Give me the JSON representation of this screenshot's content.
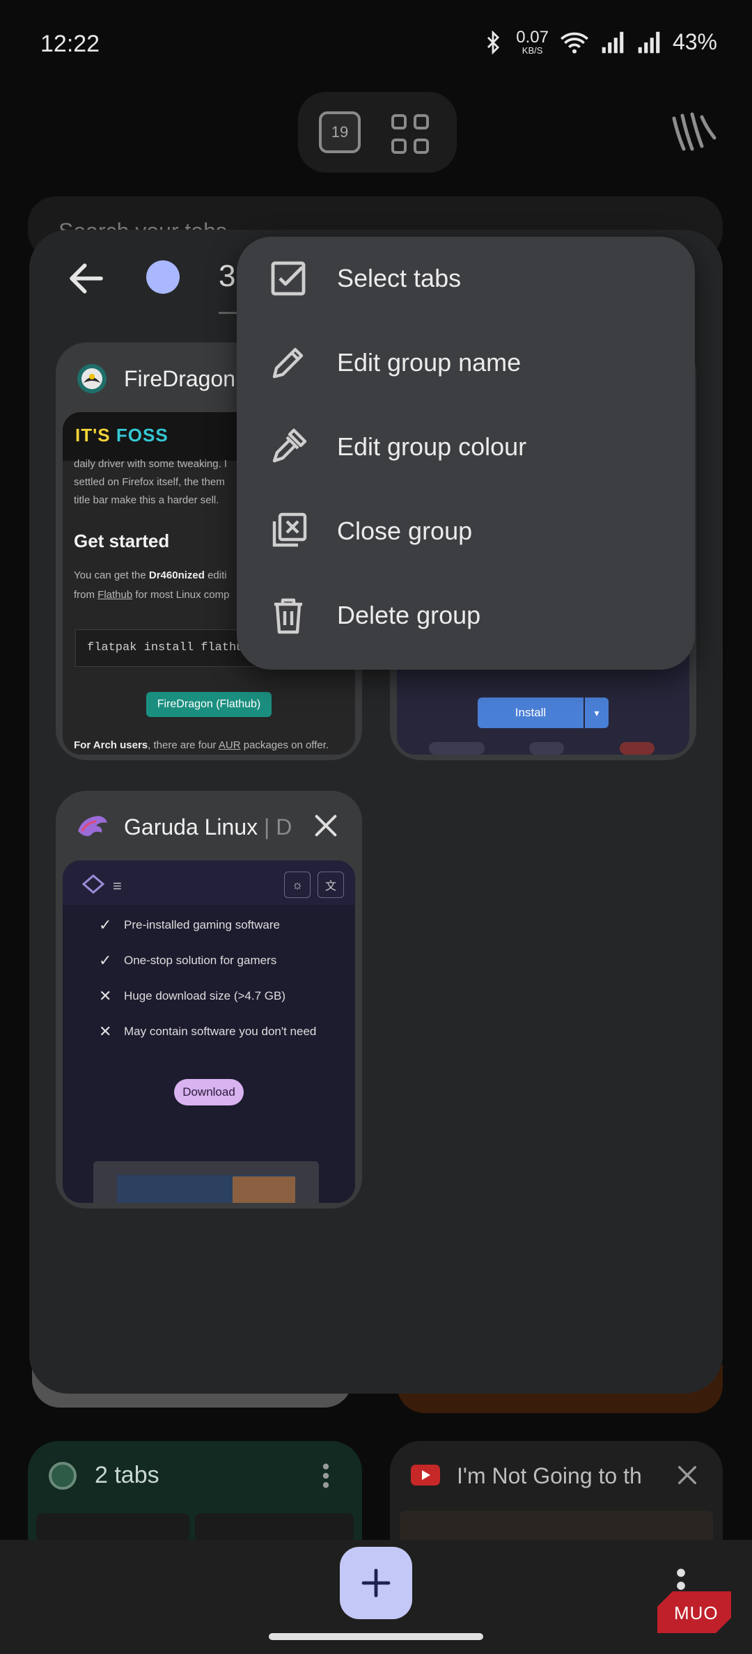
{
  "status_bar": {
    "time": "12:22",
    "net_speed_value": "0.07",
    "net_speed_unit": "KB/S",
    "battery": "43%",
    "icons": [
      "bluetooth-icon",
      "wifi-icon",
      "signal-icon",
      "signal-icon",
      "battery-icon"
    ]
  },
  "switcher": {
    "tab_count": "19"
  },
  "background": {
    "search_placeholder": "Search your tabs"
  },
  "group": {
    "color": "#a9b8ff",
    "name_partial": "3"
  },
  "menu": {
    "items": [
      {
        "label": "Select tabs",
        "icon": "checkbox-icon"
      },
      {
        "label": "Edit group name",
        "icon": "pencil-icon"
      },
      {
        "label": "Edit group colour",
        "icon": "color-picker-icon"
      },
      {
        "label": "Close group",
        "icon": "close-group-icon"
      },
      {
        "label": "Delete group",
        "icon": "trash-icon"
      }
    ]
  },
  "tabs": [
    {
      "title": "FireDragon",
      "thumbnail": {
        "logo_a": "IT'S",
        "logo_b": "FOSS",
        "line1": "daily driver with some tweaking. I",
        "line2": "settled on Firefox itself, the them",
        "line3": "title bar make this a harder sell.",
        "heading": "Get started",
        "body1a": "You can get the ",
        "body1b": "Dr460nized",
        "body1c": " editi",
        "body2a": "from ",
        "body2b": "Flathub",
        "body2c": " for most Linux comp",
        "code": "flatpak install flathub org",
        "button": "FireDragon (Flathub)",
        "footer_a": "For Arch users",
        "footer_b": ", there are four ",
        "footer_c": "AUR",
        "footer_d": " packages on offer."
      }
    },
    {
      "title": "",
      "thumbnail": {
        "button": "Install"
      }
    },
    {
      "title": "Garuda Linux",
      "title_suffix": " | D",
      "thumbnail": {
        "items": [
          {
            "mark": "✓",
            "text": "Pre-installed gaming software"
          },
          {
            "mark": "✓",
            "text": "One-stop solution for gamers"
          },
          {
            "mark": "✕",
            "text": "Huge download size (>4.7 GB)"
          },
          {
            "mark": "✕",
            "text": "May contain software you don't need"
          }
        ],
        "button": "Download"
      }
    }
  ],
  "bottom_cards": [
    {
      "title": "2 tabs"
    },
    {
      "title": "I'm Not Going to th"
    }
  ],
  "watermark": "MUO"
}
